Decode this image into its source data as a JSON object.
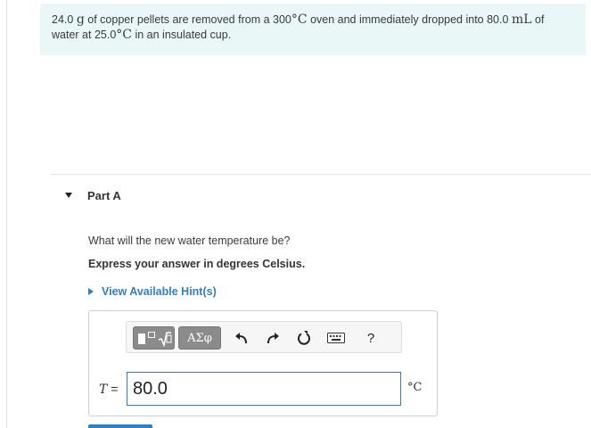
{
  "problem": {
    "mass_value": "24.0",
    "mass_unit": "g",
    "text_1": " of copper pellets are removed from a ",
    "oven_temp": "300",
    "temp_unit": "°C",
    "text_2": " oven and immediately dropped into ",
    "water_volume": "80.0",
    "volume_unit": "mL",
    "text_3": " of water at ",
    "water_temp": "25.0",
    "text_4": " in an insulated cup."
  },
  "part": {
    "title": "Part A",
    "question": "What will the new water temperature be?",
    "instruction": "Express your answer in degrees Celsius.",
    "hint_link": "View Available Hint(s)"
  },
  "toolbar": {
    "greek_label": "ΑΣφ",
    "help_label": "?",
    "icons": [
      "templates-icon",
      "undo-icon",
      "redo-icon",
      "reset-icon",
      "keyboard-icon",
      "help-icon"
    ]
  },
  "answer": {
    "variable": "T",
    "equals": " = ",
    "value": "80.0",
    "unit": "°C"
  },
  "colors": {
    "problem_bg": "#e9f7f6",
    "link": "#2f7fc6",
    "tool_button": "#8b8b8b"
  }
}
